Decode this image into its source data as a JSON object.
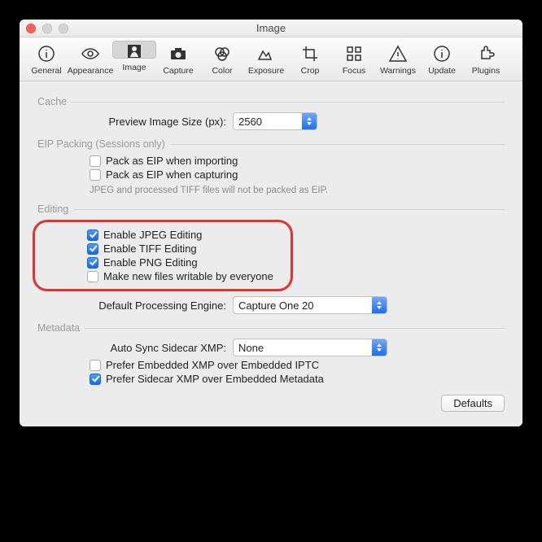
{
  "window": {
    "title": "Image"
  },
  "toolbar": {
    "items": [
      {
        "label": "General"
      },
      {
        "label": "Appearance"
      },
      {
        "label": "Image"
      },
      {
        "label": "Capture"
      },
      {
        "label": "Color"
      },
      {
        "label": "Exposure"
      },
      {
        "label": "Crop"
      },
      {
        "label": "Focus"
      },
      {
        "label": "Warnings"
      },
      {
        "label": "Update"
      },
      {
        "label": "Plugins"
      }
    ]
  },
  "cache": {
    "title": "Cache",
    "preview_size_label": "Preview Image Size (px):",
    "preview_size_value": "2560"
  },
  "eip": {
    "title": "EIP Packing (Sessions only)",
    "pack_import": "Pack as EIP when importing",
    "pack_capture": "Pack as EIP when capturing",
    "note": "JPEG and processed TIFF files will not be packed as EIP."
  },
  "editing": {
    "title": "Editing",
    "jpeg": "Enable JPEG Editing",
    "tiff": "Enable TIFF Editing",
    "png": "Enable PNG Editing",
    "writable": "Make new files writable by everyone",
    "engine_label": "Default Processing Engine:",
    "engine_value": "Capture One 20"
  },
  "metadata": {
    "title": "Metadata",
    "sync_label": "Auto Sync Sidecar XMP:",
    "sync_value": "None",
    "prefer_embedded": "Prefer Embedded XMP over Embedded IPTC",
    "prefer_sidecar": "Prefer Sidecar XMP over Embedded Metadata"
  },
  "footer": {
    "defaults": "Defaults"
  }
}
